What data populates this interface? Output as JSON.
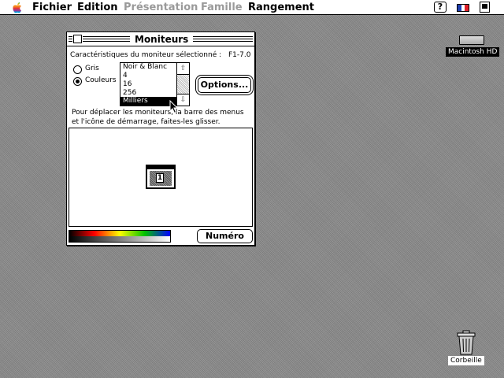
{
  "menubar": {
    "items": [
      {
        "label": "Fichier",
        "enabled": true
      },
      {
        "label": "Edition",
        "enabled": true
      },
      {
        "label": "Présentation",
        "enabled": false
      },
      {
        "label": "Famille",
        "enabled": false
      },
      {
        "label": "Rangement",
        "enabled": true
      }
    ],
    "help_label": "?",
    "icons": [
      "apple-icon",
      "help-icon",
      "french-flag-icon",
      "application-icon"
    ]
  },
  "window": {
    "title": "Moniteurs",
    "characteristics_label": "Caractéristiques du moniteur sélectionné :",
    "version": "F1-7.0",
    "radios": [
      {
        "label": "Gris",
        "selected": false
      },
      {
        "label": "Couleurs",
        "selected": true
      }
    ],
    "depth_list": {
      "items": [
        "Noir & Blanc",
        "4",
        "16",
        "256",
        "Milliers"
      ],
      "selected": "Milliers"
    },
    "options_label": "Options...",
    "instructions_line1": "Pour déplacer les moniteurs, la barre des menus",
    "instructions_line2": "et l'icône de démarrage, faites-les glisser.",
    "monitor_number": "1",
    "identify_label": "Numéro"
  },
  "desktop": {
    "hard_disk_label": "Macintosh HD",
    "trash_label": "Corbeille"
  },
  "colors": {
    "desktop": "#8c8c8c",
    "flag_blue": "#1f3fb0",
    "flag_red": "#e0202a",
    "apple_stripes": [
      "#61bb46",
      "#fdb827",
      "#f5821f",
      "#e03a3e",
      "#963d97",
      "#009ddc"
    ],
    "spectrum": [
      "#000000",
      "#ff0000",
      "#ffff00",
      "#00c000",
      "#0000ff"
    ]
  }
}
